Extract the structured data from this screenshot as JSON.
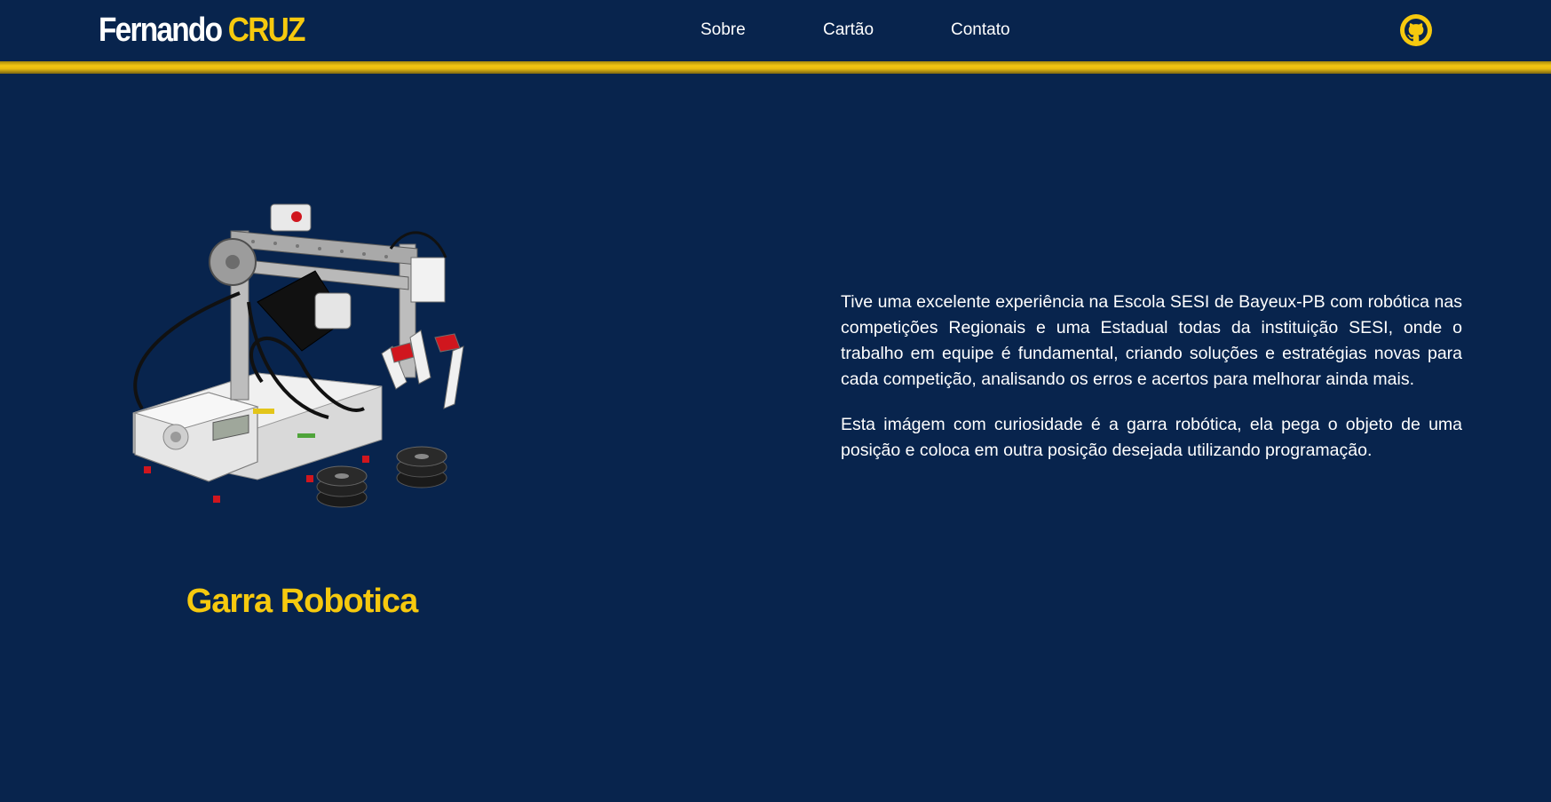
{
  "header": {
    "brand_first": "Fernando",
    "brand_last": "CRUZ",
    "nav": [
      {
        "label": "Sobre"
      },
      {
        "label": "Cartão"
      },
      {
        "label": "Contato"
      }
    ],
    "github_icon": "github-icon"
  },
  "main": {
    "image_caption": "Garra Robotica",
    "paragraphs": [
      "Tive uma excelente experiência na Escola SESI de Bayeux-PB com robótica nas competições Regionais e uma Estadual todas da instituição SESI, onde o trabalho em equipe é fundamental, criando soluções e estratégias novas para cada competição, analisando os erros e acertos para melhorar ainda mais.",
      "Esta imágem com curiosidade é a garra robótica, ela pega o objeto de uma posição e coloca em outra posição desejada utilizando programação."
    ]
  },
  "colors": {
    "background": "#08244d",
    "accent": "#f6c90e",
    "text": "#ffffff"
  }
}
